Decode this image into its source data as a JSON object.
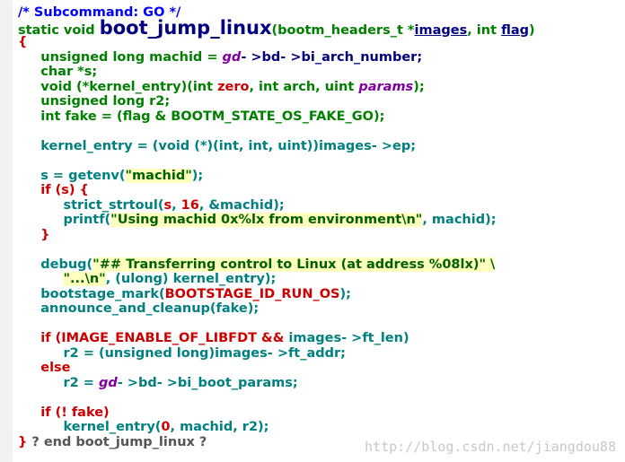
{
  "colors": {
    "default": "#000080",
    "keyword": "#008000",
    "builtin_type": "#0000c0",
    "control": "#cc0000",
    "string": "#006000",
    "string_bg": "#ffffc0",
    "number": "#cc0000",
    "param": "#8000a0",
    "function": "#008080",
    "comment": "#0000ff"
  },
  "code_lines": [
    [
      {
        "t": "/* Subcommand: GO */",
        "c": "comment"
      }
    ],
    [
      {
        "t": "static void ",
        "c": "keyword"
      },
      {
        "t": "boot_jump_linux",
        "c": "default",
        "big": true
      },
      {
        "t": "(bootm_headers_t *",
        "c": "keyword"
      },
      {
        "t": "images",
        "c": "default",
        "u": true
      },
      {
        "t": ", int ",
        "c": "keyword"
      },
      {
        "t": "flag",
        "c": "default",
        "u": true
      },
      {
        "t": ")",
        "c": "keyword"
      }
    ],
    [
      {
        "t": "{",
        "c": "control"
      }
    ],
    [
      {
        "t": "     unsigned long machid = ",
        "c": "keyword"
      },
      {
        "t": "gd",
        "c": "param",
        "i": true
      },
      {
        "t": "- >bd- >bi_arch_number;",
        "c": "default"
      }
    ],
    [
      {
        "t": "     char *s;",
        "c": "keyword"
      }
    ],
    [
      {
        "t": "     void (*kernel_entry)(int ",
        "c": "keyword"
      },
      {
        "t": "zero",
        "c": "control"
      },
      {
        "t": ", int arch, uint ",
        "c": "keyword"
      },
      {
        "t": "params",
        "c": "param",
        "i": true
      },
      {
        "t": ");",
        "c": "keyword"
      }
    ],
    [
      {
        "t": "     unsigned long r2;",
        "c": "keyword"
      }
    ],
    [
      {
        "t": "     int fake = (flag & BOOTM_STATE_OS_FAKE_GO);",
        "c": "keyword"
      }
    ],
    [
      {
        "t": "",
        "c": "default"
      }
    ],
    [
      {
        "t": "     kernel_entry = (void (*)(int, int, uint))images- >ep;",
        "c": "function"
      }
    ],
    [
      {
        "t": "",
        "c": "default"
      }
    ],
    [
      {
        "t": "     s = getenv(",
        "c": "function"
      },
      {
        "t": "\"machid\"",
        "c": "string",
        "bg": true
      },
      {
        "t": ");",
        "c": "function"
      }
    ],
    [
      {
        "t": "     if (s) {",
        "c": "control"
      }
    ],
    [
      {
        "t": "          strict_strtoul(",
        "c": "function"
      },
      {
        "t": "s",
        "c": "control"
      },
      {
        "t": ", ",
        "c": "function"
      },
      {
        "t": "16",
        "c": "number"
      },
      {
        "t": ", &machid);",
        "c": "function"
      }
    ],
    [
      {
        "t": "          printf(",
        "c": "function"
      },
      {
        "t": "\"Using machid 0x%lx from environment\\n\"",
        "c": "string",
        "bg": true
      },
      {
        "t": ", machid);",
        "c": "function"
      }
    ],
    [
      {
        "t": "     }",
        "c": "control"
      }
    ],
    [
      {
        "t": "",
        "c": "default"
      }
    ],
    [
      {
        "t": "     debug(",
        "c": "function"
      },
      {
        "t": "\"## Transferring control to Linux (at address %08lx)\" \\",
        "c": "string",
        "bg": true
      }
    ],
    [
      {
        "t": "          ",
        "c": "default"
      },
      {
        "t": "\"...\\n\"",
        "c": "string",
        "bg": true
      },
      {
        "t": ", (ulong) kernel_entry);",
        "c": "function"
      }
    ],
    [
      {
        "t": "     bootstage_mark(",
        "c": "function"
      },
      {
        "t": "BOOTSTAGE_ID_RUN_OS",
        "c": "control"
      },
      {
        "t": ");",
        "c": "function"
      }
    ],
    [
      {
        "t": "     announce_and_cleanup(fake);",
        "c": "function"
      }
    ],
    [
      {
        "t": "",
        "c": "default"
      }
    ],
    [
      {
        "t": "     if (IMAGE_ENABLE_OF_LIBFDT && ",
        "c": "control"
      },
      {
        "t": "images- >ft_len)",
        "c": "function"
      }
    ],
    [
      {
        "t": "          r2 = (unsigned long)images- >ft_addr;",
        "c": "function"
      }
    ],
    [
      {
        "t": "     else",
        "c": "control"
      }
    ],
    [
      {
        "t": "          r2 = ",
        "c": "function"
      },
      {
        "t": "gd",
        "c": "param",
        "i": true
      },
      {
        "t": "- >bd- >bi_boot_params;",
        "c": "function"
      }
    ],
    [
      {
        "t": "",
        "c": "default"
      }
    ],
    [
      {
        "t": "     if (! fake)",
        "c": "control"
      }
    ],
    [
      {
        "t": "          kernel_entry(",
        "c": "function"
      },
      {
        "t": "0",
        "c": "number"
      },
      {
        "t": ", machid, r2);",
        "c": "function"
      }
    ],
    [
      {
        "t": "} ",
        "c": "control"
      },
      {
        "t": "? end boot_jump_linux ?",
        "c": "gray"
      }
    ]
  ],
  "watermark": "http://blog.csdn.net/jiangdou88"
}
